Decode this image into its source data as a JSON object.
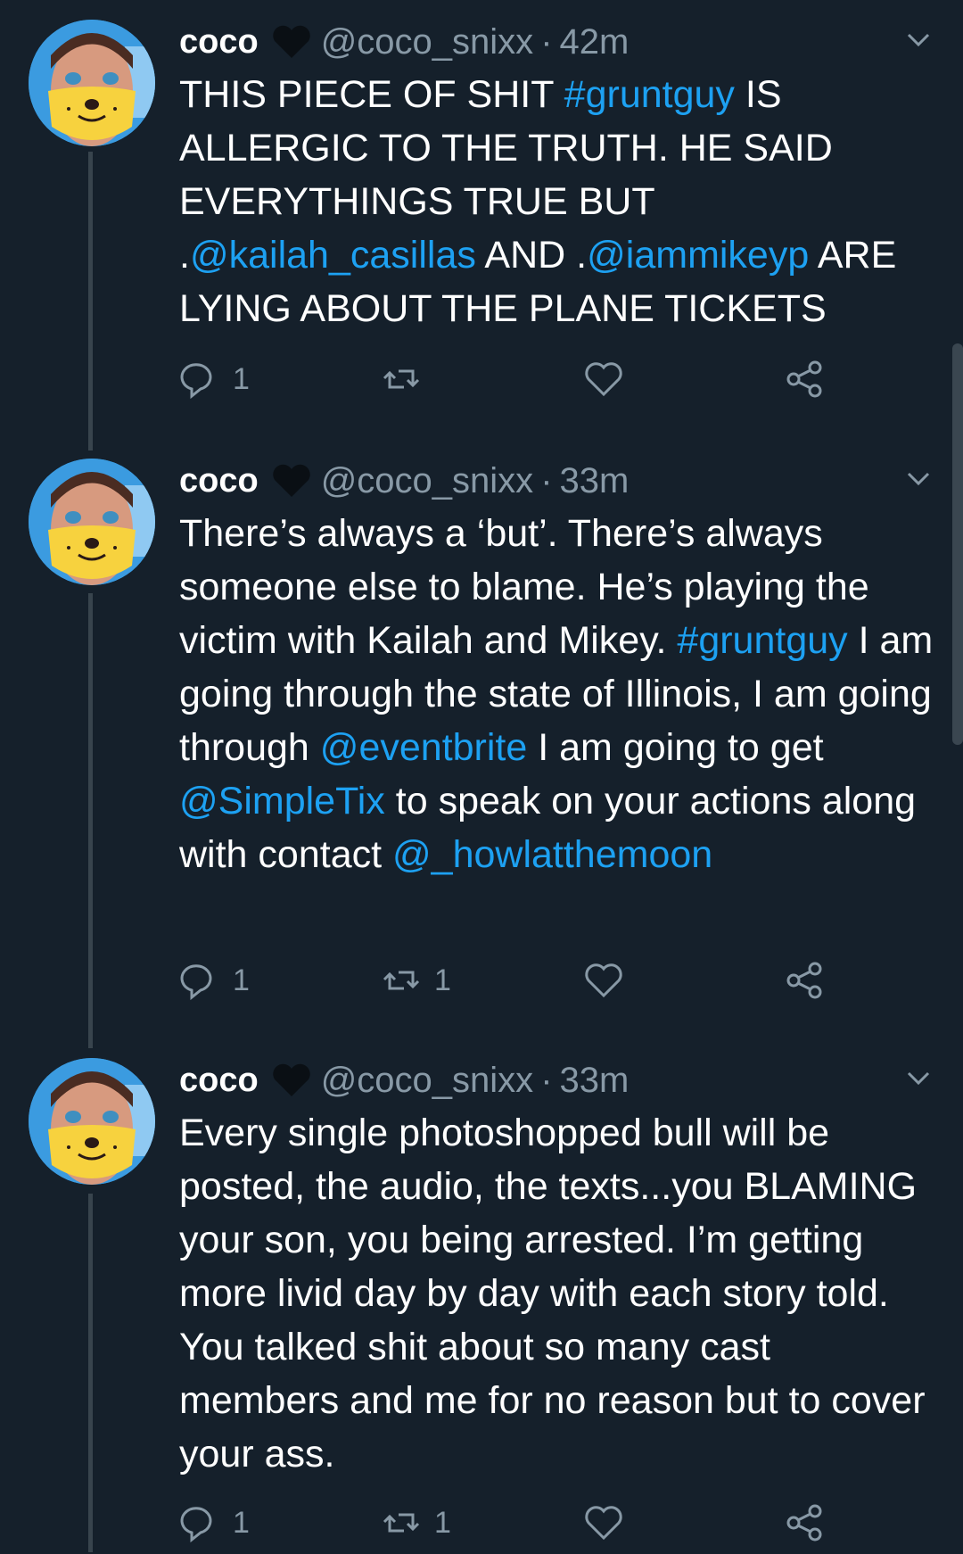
{
  "tweets": [
    {
      "name": "coco",
      "handle": "@coco_snixx",
      "separator": "·",
      "time": "42m",
      "body": [
        {
          "t": "THIS PIECE OF SHIT ",
          "link": false
        },
        {
          "t": "#gruntguy",
          "link": true
        },
        {
          "t": " IS ALLERGIC TO THE TRUTH. HE SAID EVERYTHINGS TRUE BUT .",
          "link": false
        },
        {
          "t": "@kailah_casillas",
          "link": true
        },
        {
          "t": " AND .",
          "link": false
        },
        {
          "t": "@iammikeyp",
          "link": true
        },
        {
          "t": " ARE LYING ABOUT THE PLANE TICKETS",
          "link": false
        }
      ],
      "reply_count": "1",
      "retweet_count": "",
      "like_count": ""
    },
    {
      "name": "coco",
      "handle": "@coco_snixx",
      "separator": "·",
      "time": "33m",
      "body": [
        {
          "t": "There’s always a ‘but’. There’s always someone else to blame. He’s playing the victim with Kailah and Mikey. ",
          "link": false
        },
        {
          "t": "#gruntguy",
          "link": true
        },
        {
          "t": " I am going through the state of Illinois, I am going through ",
          "link": false
        },
        {
          "t": "@eventbrite",
          "link": true
        },
        {
          "t": " I am going to get ",
          "link": false
        },
        {
          "t": "@SimpleTix",
          "link": true
        },
        {
          "t": " to speak on your actions along with contact ",
          "link": false
        },
        {
          "t": "@_howlatthemoon",
          "link": true
        }
      ],
      "reply_count": "1",
      "retweet_count": "1",
      "like_count": ""
    },
    {
      "name": "coco",
      "handle": "@coco_snixx",
      "separator": "·",
      "time": "33m",
      "body": [
        {
          "t": "Every single photoshopped bull will be posted, the audio, the texts...you BLAMING your son, you being arrested. I’m getting more livid day by day with each story told. You talked shit about so many cast members and me for no reason but to cover your ass.",
          "link": false
        }
      ],
      "reply_count": "1",
      "retweet_count": "1",
      "like_count": ""
    }
  ],
  "colors": {
    "background": "#15202b",
    "link": "#1da1f2",
    "secondary_text": "#8899a6",
    "thread_line": "#38444d"
  },
  "icons": {
    "reply": "reply-icon",
    "retweet": "retweet-icon",
    "like": "like-icon",
    "share": "share-icon",
    "caret": "chevron-down-icon",
    "badge": "black-heart-icon"
  }
}
